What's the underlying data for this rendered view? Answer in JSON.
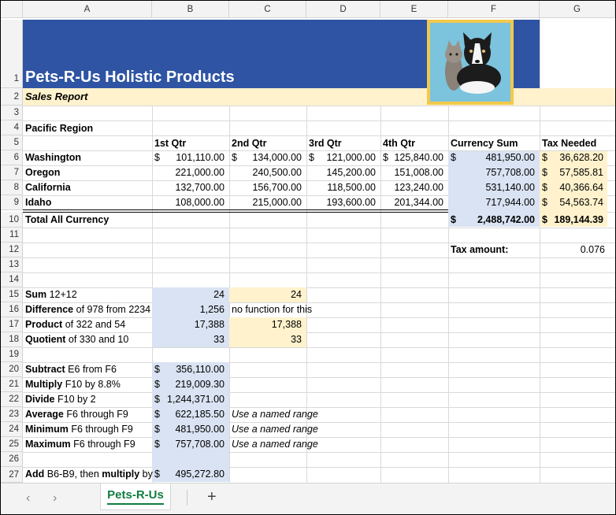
{
  "columns": [
    "A",
    "B",
    "C",
    "D",
    "E",
    "F",
    "G"
  ],
  "banner": {
    "title": "Pets-R-Us Holistic Products",
    "subtitle": "Sales Report",
    "image": "dog-and-cat-photo"
  },
  "region": "Pacific Region",
  "headers": [
    "1st Qtr",
    "2nd Qtr",
    "3rd Qtr",
    "4th Qtr",
    "Currency Sum",
    "Tax Needed"
  ],
  "states": [
    {
      "name": "Washington",
      "q1": "101,110.00",
      "q2": "134,000.00",
      "q3": "121,000.00",
      "q4": "125,840.00",
      "sum": "481,950.00",
      "tax": "36,628.20"
    },
    {
      "name": "Oregon",
      "q1": "221,000.00",
      "q2": "240,500.00",
      "q3": "145,200.00",
      "q4": "151,008.00",
      "sum": "757,708.00",
      "tax": "57,585.81"
    },
    {
      "name": "California",
      "q1": "132,700.00",
      "q2": "156,700.00",
      "q3": "118,500.00",
      "q4": "123,240.00",
      "sum": "531,140.00",
      "tax": "40,366.64"
    },
    {
      "name": "Idaho",
      "q1": "108,000.00",
      "q2": "215,000.00",
      "q3": "193,600.00",
      "q4": "201,344.00",
      "sum": "717,944.00",
      "tax": "54,563.74"
    }
  ],
  "total": {
    "label": "Total All Currency",
    "sum": "2,488,742.00",
    "tax": "189,144.39"
  },
  "tax_amount": {
    "label": "Tax amount:",
    "value": "0.076"
  },
  "dollar_sign": "$",
  "calc1": [
    {
      "bold": "Sum",
      "rest": " 12+12",
      "b": "24",
      "c": "24"
    },
    {
      "bold": "Difference",
      "rest": " of 978 from 2234",
      "b": "1,256",
      "c": "no function for this"
    },
    {
      "bold": "Product",
      "rest": " of 322 and 54",
      "b": "17,388",
      "c": "17,388"
    },
    {
      "bold": "Quotient",
      "rest": " of 330 and 10",
      "b": "33",
      "c": "33"
    }
  ],
  "calc2": [
    {
      "bold": "Subtract",
      "rest": " E6 from F6",
      "b": "356,110.00",
      "c": ""
    },
    {
      "bold": "Multiply",
      "rest": " F10 by 8.8%",
      "b": "219,009.30",
      "c": ""
    },
    {
      "bold": "Divide",
      "rest": " F10 by 2",
      "b": "1,244,371.00",
      "c": ""
    },
    {
      "bold": "Average",
      "rest": " F6 through F9",
      "b": "622,185.50",
      "c": "Use a named range"
    },
    {
      "bold": "Minimum",
      "rest": " F6 through F9",
      "b": "481,950.00",
      "c": "Use a named range"
    },
    {
      "bold": "Maximum",
      "rest": " F6 through F9",
      "b": "757,708.00",
      "c": "Use a named range"
    }
  ],
  "row27": {
    "bold1": "Add",
    "mid": " B6-B9, then ",
    "bold2": "multiply",
    "rest": " by",
    "b": "495,272.80"
  },
  "tabs": {
    "sheet": "Pets-R-Us",
    "add": "+",
    "prev": "‹",
    "next": "›"
  },
  "colors": {
    "banner": "#2f54a3",
    "subtitle_bg": "#fff2cc",
    "blue_fill": "#dae3f3",
    "tan_fill": "#fff2cc",
    "tab_green": "#107c41"
  }
}
